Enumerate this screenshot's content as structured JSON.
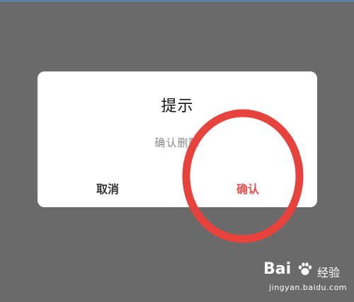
{
  "dialog": {
    "title": "提示",
    "message": "确认删除",
    "cancel_label": "取消",
    "confirm_label": "确认"
  },
  "watermark": {
    "logo_text": "Bai",
    "logo_suffix": "经验",
    "url": "jingyan.baidu.com"
  },
  "colors": {
    "overlay": "#6a6a6a",
    "dialog_bg": "#ffffff",
    "confirm_accent": "#e8514f",
    "annotation_circle": "#e8423c"
  }
}
